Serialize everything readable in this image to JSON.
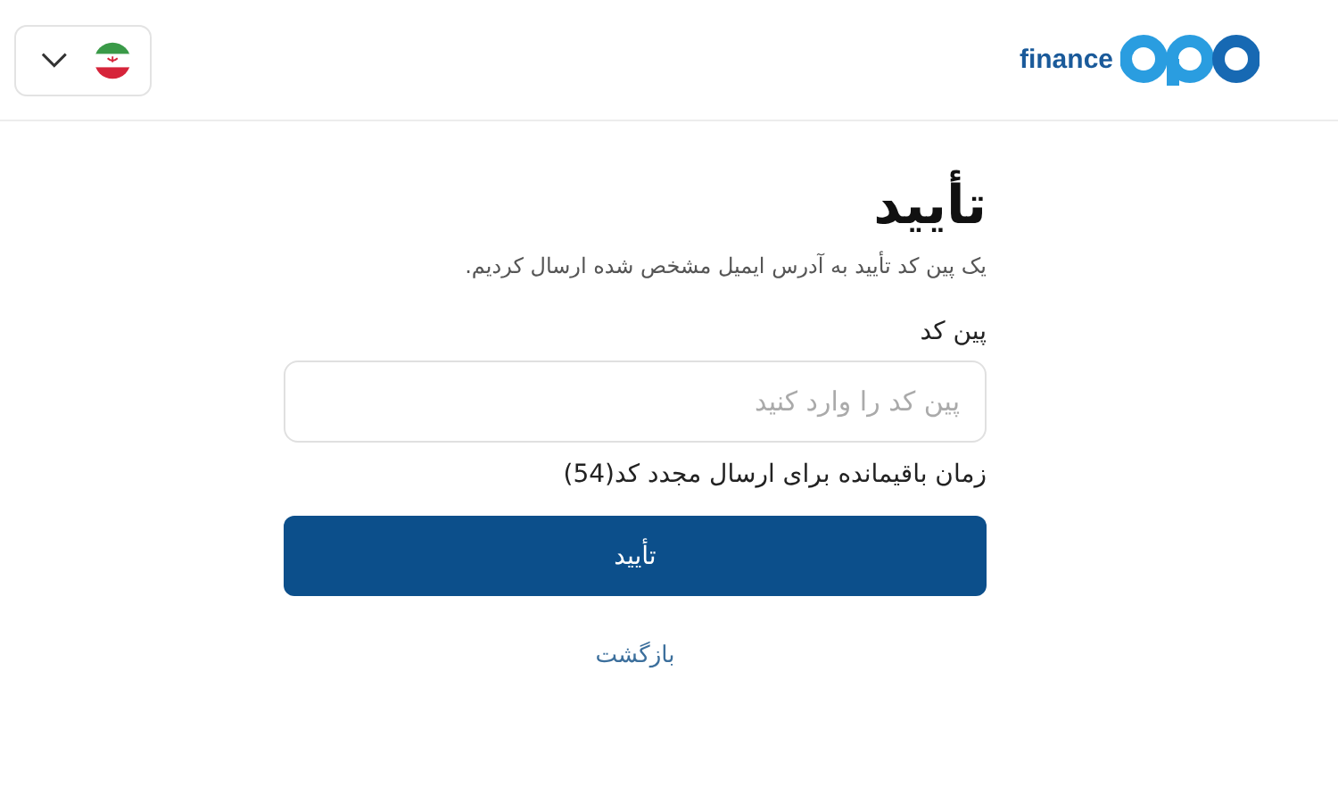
{
  "header": {
    "logo_text": "finance",
    "language": {
      "expanded": false
    }
  },
  "form": {
    "title": "تأیید",
    "subtitle": "یک پین کد تأیید به آدرس ایمیل مشخص شده ارسال کردیم.",
    "pin_label": "پین کد",
    "pin_placeholder": "پین کد را وارد کنید",
    "timer": "زمان باقیمانده برای ارسال مجدد کد(54)",
    "submit": "تأیید",
    "back": "بازگشت"
  }
}
